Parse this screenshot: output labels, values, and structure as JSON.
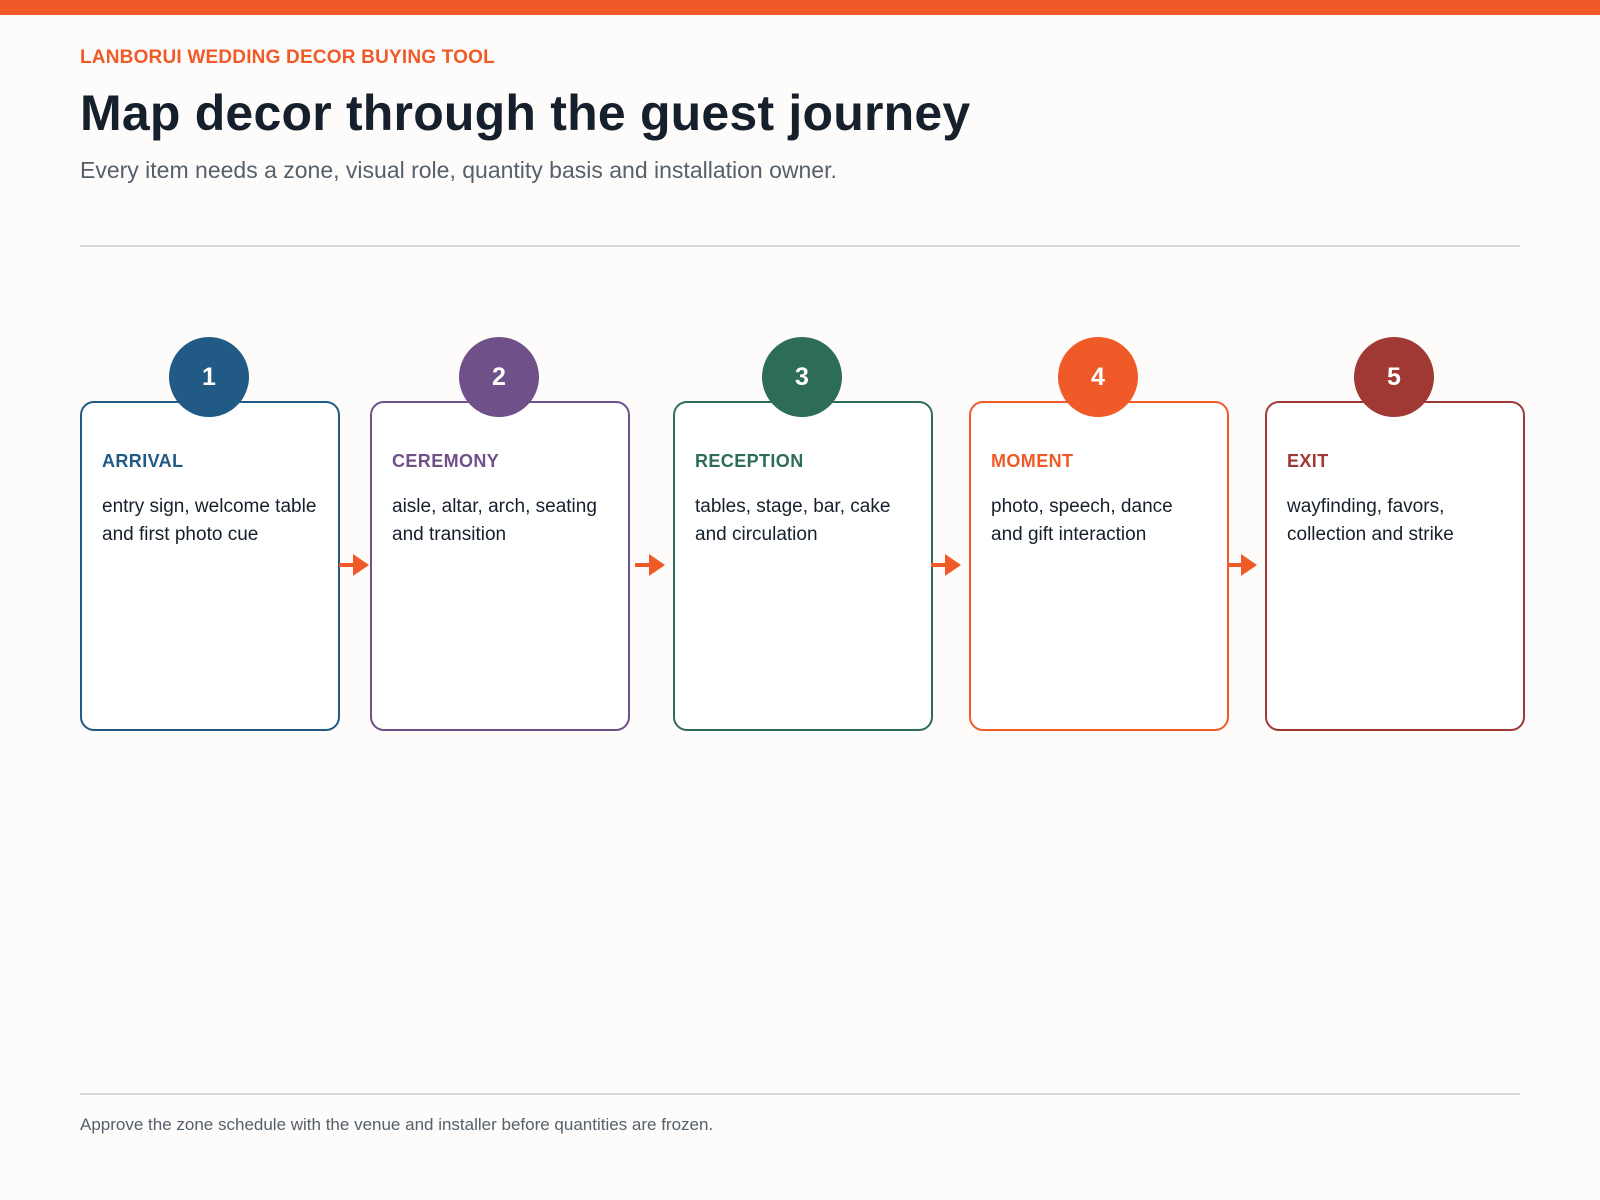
{
  "header": {
    "eyebrow": "LANBORUI WEDDING DECOR BUYING TOOL",
    "title": "Map decor through the guest journey",
    "subtitle": "Every item needs a zone, visual role, quantity basis and installation owner."
  },
  "steps": [
    {
      "number": "1",
      "phase": "ARRIVAL",
      "description": "entry sign, welcome table and first photo cue",
      "color": "#205a85"
    },
    {
      "number": "2",
      "phase": "CEREMONY",
      "description": "aisle, altar, arch, seating and transition",
      "color": "#6f5088"
    },
    {
      "number": "3",
      "phase": "RECEPTION",
      "description": "tables, stage, bar, cake and circulation",
      "color": "#2e6d55"
    },
    {
      "number": "4",
      "phase": "MOMENT",
      "description": "photo, speech, dance and gift interaction",
      "color": "#f05a28"
    },
    {
      "number": "5",
      "phase": "EXIT",
      "description": "wayfinding, favors, collection and strike",
      "color": "#a03834"
    }
  ],
  "accent_color": "#f05a28",
  "arrow_icon": "arrow-right-icon",
  "footer": {
    "note": "Approve the zone schedule with the venue and installer before quantities are frozen."
  }
}
